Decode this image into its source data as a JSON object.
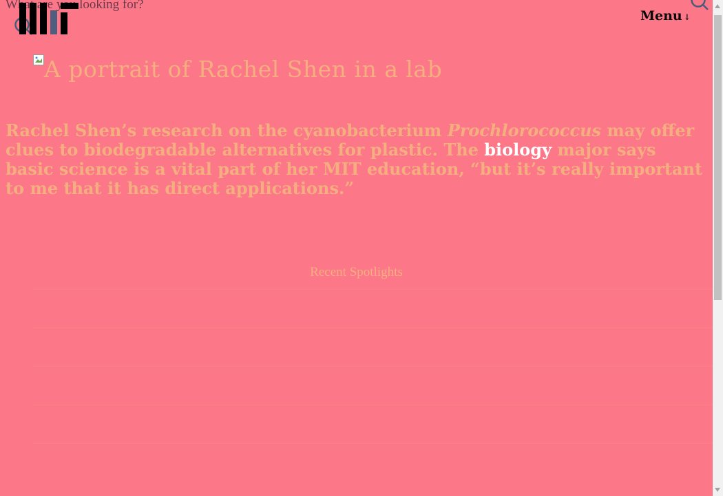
{
  "search": {
    "label": "What are you looking for?"
  },
  "header": {
    "logo_icon": "mit-logo-icon",
    "menu_label": "Menu",
    "menu_arrow": "↓"
  },
  "hero": {
    "image_alt": "A portrait of Rachel Shen in a lab"
  },
  "intro": {
    "part1": "Rachel Shen’s research on the cyanobacterium ",
    "species": "Prochlorococcus",
    "part2": " may offer clues to biodegradable alternatives for plastic. The ",
    "major_link": "biology",
    "part3": " major says basic science is a vital part of her MIT education, “but it’s really important to me that it has direct applications.”"
  },
  "recent": {
    "heading": "Recent Spotlights",
    "items": [
      "",
      "",
      "",
      "",
      ""
    ]
  },
  "colors": {
    "background": "#fc7888",
    "accent_text": "#f5ae80",
    "highlight": "#ffffff"
  }
}
